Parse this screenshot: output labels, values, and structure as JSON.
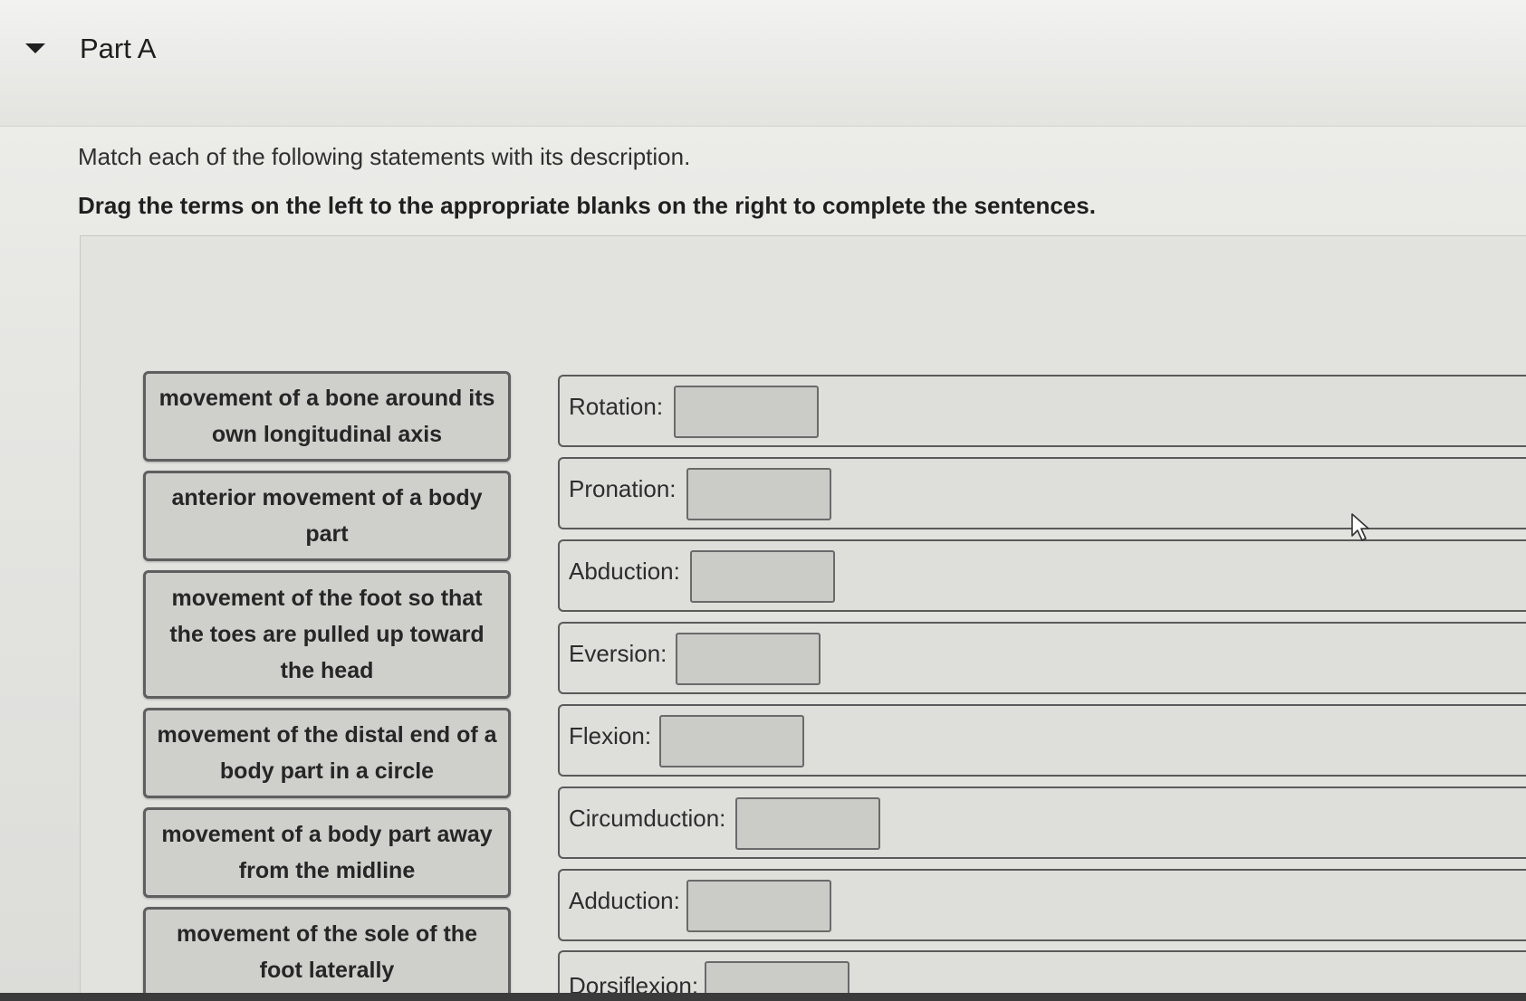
{
  "header": {
    "title": "Part A"
  },
  "instructions": {
    "text": "Match each of the following statements with its description.",
    "bold": "Drag the terms on the left to the appropriate blanks on the right to complete the sentences."
  },
  "terms": [
    "movement of a bone around its own longitudinal axis",
    "anterior movement of a body part",
    "movement of the foot so that the toes are pulled up toward the head",
    "movement of the distal end of a body part in a circle",
    "movement of a body part away from the midline",
    "movement of the sole of the foot laterally"
  ],
  "rows": [
    "Rotation:",
    "Pronation:",
    "Abduction:",
    "Eversion:",
    "Flexion:",
    "Circumduction:",
    "Adduction:",
    "Dorsiflexion:"
  ],
  "icons": {
    "collapse": "caret-down-icon",
    "pointer": "mouse-cursor-icon"
  }
}
